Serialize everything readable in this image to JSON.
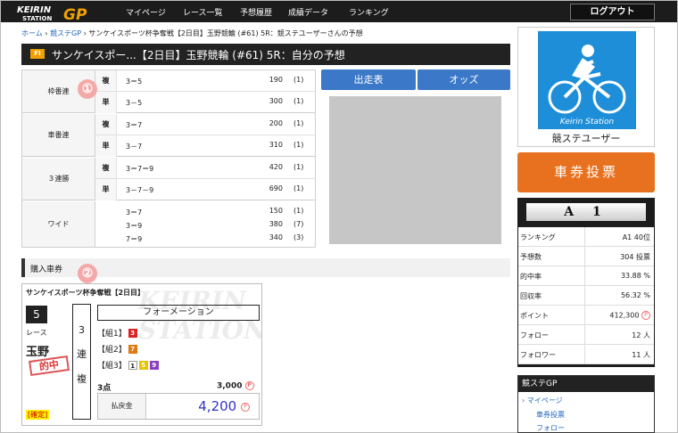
{
  "header": {
    "logo_text": "KEIRIN STATION",
    "logo_gp": "GP",
    "nav": [
      "マイページ",
      "レース一覧",
      "予想履歴",
      "成績データ",
      "ランキング"
    ],
    "logout": "ログアウト"
  },
  "breadcrumb": [
    "ホーム",
    "競ステGP",
    "サンケイスポーツ杯争奪戦【2日目】玉野競輪 (#61) 5R：競ステユーザーさんの予想"
  ],
  "title_badge": "FI",
  "title": "サンケイスポー...【2日目】玉野競輪 (#61) 5R：自分の予想",
  "prediction": {
    "bets": [
      {
        "type": "枠番連",
        "rows": [
          {
            "sub": "複",
            "combo": "3＝5",
            "payout": "190",
            "popularity": "(1)"
          },
          {
            "sub": "単",
            "combo": "3－5",
            "payout": "300",
            "popularity": "(1)"
          }
        ]
      },
      {
        "type": "車番連",
        "rows": [
          {
            "sub": "複",
            "combo": "3＝7",
            "payout": "200",
            "popularity": "(1)"
          },
          {
            "sub": "単",
            "combo": "3－7",
            "payout": "310",
            "popularity": "(1)"
          }
        ]
      },
      {
        "type": "３連勝",
        "rows": [
          {
            "sub": "複",
            "combo": "3＝7＝9",
            "payout": "420",
            "popularity": "(1)"
          },
          {
            "sub": "単",
            "combo": "3－7－9",
            "payout": "690",
            "popularity": "(1)"
          }
        ]
      },
      {
        "type": "ワイド",
        "rows": [
          {
            "combo": "3＝7",
            "payout": "150",
            "popularity": "(1)"
          },
          {
            "combo": "3＝9",
            "payout": "380",
            "popularity": "(7)"
          },
          {
            "combo": "7＝9",
            "payout": "340",
            "popularity": "(3)"
          }
        ]
      }
    ]
  },
  "buttons": {
    "entries": "出走表",
    "odds": "オッズ"
  },
  "markers": [
    "①",
    "②"
  ],
  "purchase": {
    "heading": "購入車券",
    "watermark": "KEIRIN STATION",
    "race_name": "サンケイスポーツ杯争奪戦【2日目】",
    "race_no": "5",
    "race_label": "レース",
    "venue": "玉野",
    "stamp": "的中",
    "fixed": "[確定]",
    "bet_type_chars": [
      "3",
      "連",
      "複"
    ],
    "method": "フォーメーション",
    "groups": [
      {
        "label": "【組1】",
        "nums": [
          {
            "n": "3",
            "color": "#dd2222"
          }
        ]
      },
      {
        "label": "【組2】",
        "nums": [
          {
            "n": "7",
            "color": "#e07a10"
          }
        ]
      },
      {
        "label": "【組3】",
        "nums": [
          {
            "n": "1",
            "color": "#ffffff"
          },
          {
            "n": "5",
            "color": "#e8c400"
          },
          {
            "n": "9",
            "color": "#8a3fbf"
          }
        ]
      }
    ],
    "points": "3点",
    "points_value": "3,000",
    "p_glyph": "P",
    "payout_label": "払戻金",
    "payout_value": "4,200"
  },
  "user": {
    "card_text": "Keirin Station",
    "name": "競ステユーザー"
  },
  "vote_button": "車券投票",
  "stats": {
    "rank": "A 1",
    "rows": [
      {
        "label": "ランキング",
        "value": "A1 40位"
      },
      {
        "label": "予想数",
        "value": "304 投票"
      },
      {
        "label": "的中率",
        "value": "33.88 %"
      },
      {
        "label": "回収率",
        "value": "56.32 %"
      },
      {
        "label": "ポイント",
        "value": "412,300"
      },
      {
        "label": "フォロー",
        "value": "12 人"
      },
      {
        "label": "フォロワー",
        "value": "11 人"
      }
    ]
  },
  "menu": {
    "heading": "競ステGP",
    "items": [
      "› マイページ",
      "車券投票",
      "フォロー"
    ]
  }
}
